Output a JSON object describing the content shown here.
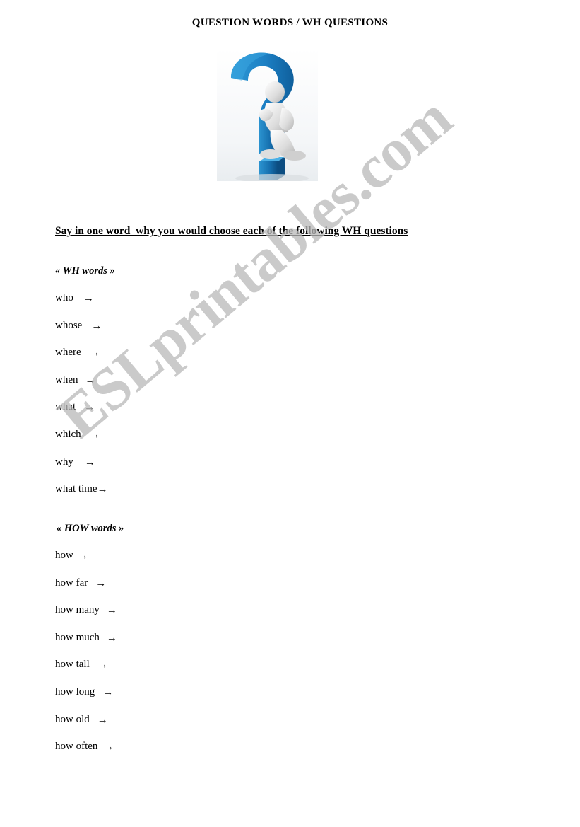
{
  "document": {
    "title": "QUESTION WORDS / WH QUESTIONS",
    "instruction": "Say in one word  why you would choose each of the following WH questions",
    "watermark": "ESLprintables.com",
    "illustration_name": "question-mark-with-thinking-figure"
  },
  "sections": [
    {
      "heading": "« WH words »",
      "items": [
        {
          "term": "who",
          "arrow": "→"
        },
        {
          "term": "whose",
          "arrow": "→"
        },
        {
          "term": "where",
          "arrow": "→"
        },
        {
          "term": "when",
          "arrow": "→"
        },
        {
          "term": "what",
          "arrow": "→"
        },
        {
          "term": "which",
          "arrow": "→"
        },
        {
          "term": "why",
          "arrow": "→"
        },
        {
          "term": "what time",
          "arrow": "→"
        }
      ]
    },
    {
      "heading": "« HOW words »",
      "items": [
        {
          "term": "how",
          "arrow": "→"
        },
        {
          "term": "how far",
          "arrow": "→"
        },
        {
          "term": "how many",
          "arrow": "→"
        },
        {
          "term": "how much",
          "arrow": "→"
        },
        {
          "term": "how tall",
          "arrow": "→"
        },
        {
          "term": "how long",
          "arrow": "→"
        },
        {
          "term": "how old",
          "arrow": "→"
        },
        {
          "term": "how often",
          "arrow": "→"
        }
      ]
    }
  ],
  "colors": {
    "question_mark_blue": "#1c7fc4",
    "question_mark_blue_dark": "#115b92",
    "figure_grey": "#d8d8d8",
    "watermark_grey": "#b9b9b9"
  }
}
